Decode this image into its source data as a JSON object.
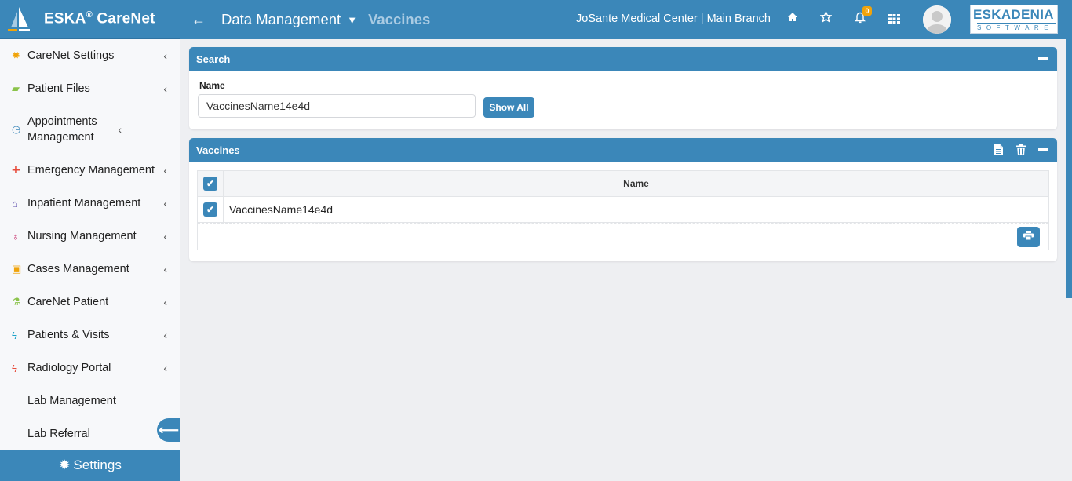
{
  "brand": {
    "name": "ESKA",
    "reg": "®",
    "suffix": " CareNet"
  },
  "sidebar": {
    "items": [
      {
        "label": "CareNet Settings",
        "icon": "gear-icon",
        "color": "#f0a30a",
        "glyph": "✹"
      },
      {
        "label": "Patient Files",
        "icon": "folder-icon",
        "color": "#8bc34a",
        "glyph": "▰"
      },
      {
        "label": "Appointments Management",
        "icon": "clock-icon",
        "color": "#3b87b9",
        "glyph": "◷"
      },
      {
        "label": "Emergency Management",
        "icon": "plus-icon",
        "color": "#e74c3c",
        "glyph": "✚"
      },
      {
        "label": "Inpatient Management",
        "icon": "home-icon",
        "color": "#5c4dac",
        "glyph": "⌂"
      },
      {
        "label": "Nursing Management",
        "icon": "stethoscope-icon",
        "color": "#c2185b",
        "glyph": "♁"
      },
      {
        "label": "Cases Management",
        "icon": "image-icon",
        "color": "#f0a30a",
        "glyph": "▣"
      },
      {
        "label": "CareNet Patient",
        "icon": "flask-icon",
        "color": "#8bc34a",
        "glyph": "⚗"
      },
      {
        "label": "Patients & Visits",
        "icon": "bolt-icon",
        "color": "#1ba1c8",
        "glyph": "ϟ"
      },
      {
        "label": "Radiology Portal",
        "icon": "bolt-icon",
        "color": "#e74c3c",
        "glyph": "ϟ"
      },
      {
        "label": "Lab Management",
        "icon": "",
        "color": "",
        "glyph": ""
      },
      {
        "label": "Lab Referral",
        "icon": "",
        "color": "",
        "glyph": ""
      }
    ],
    "settings_label": "Settings"
  },
  "header": {
    "breadcrumb_main": "Data Management",
    "breadcrumb_sub": "Vaccines",
    "org": "JoSante Medical Center | Main Branch",
    "notification_count": "0",
    "logo_top": "ESKADENIA",
    "logo_bottom": "SOFTWARE"
  },
  "search_panel": {
    "title": "Search",
    "name_label": "Name",
    "name_value": "VaccinesName14e4d",
    "show_all_label": "Show All"
  },
  "vaccines_panel": {
    "title": "Vaccines",
    "column_name": "Name",
    "rows": [
      {
        "name": "VaccinesName14e4d",
        "checked": true
      }
    ]
  }
}
